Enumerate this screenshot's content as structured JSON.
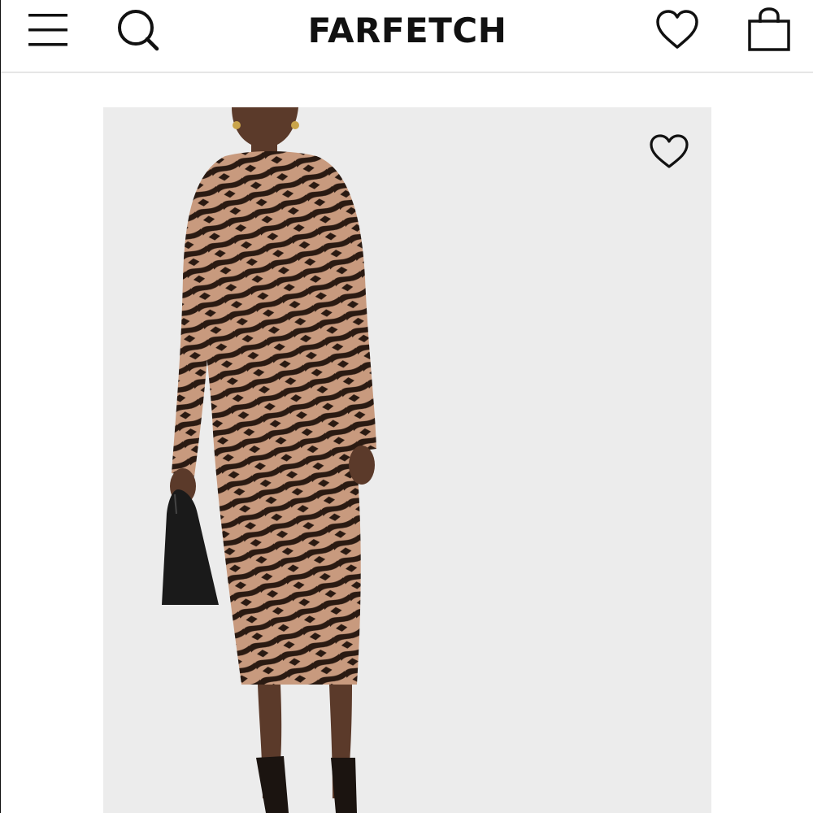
{
  "header": {
    "logo_text": "FARFETCH",
    "icons": {
      "menu": "menu-icon",
      "search": "search-icon",
      "wishlist": "heart-icon",
      "bag": "shopping-bag-icon"
    }
  },
  "product": {
    "image_description_icon": "product-photo",
    "wishlist_icon": "heart-icon",
    "colors": {
      "background": "#ececec",
      "dress_base": "#c89a7e",
      "dress_pattern": "#2a1a12",
      "bag": "#1a1a1a"
    }
  }
}
